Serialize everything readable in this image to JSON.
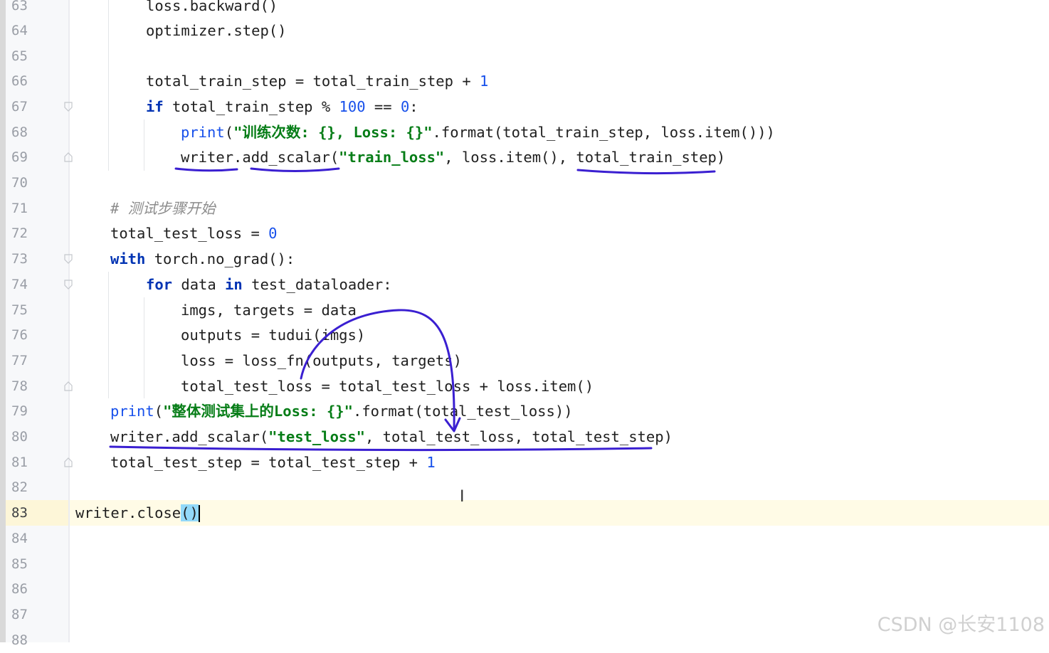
{
  "editor": {
    "line_numbers": [
      "63",
      "64",
      "65",
      "66",
      "67",
      "68",
      "69",
      "70",
      "71",
      "72",
      "73",
      "74",
      "75",
      "76",
      "77",
      "78",
      "79",
      "80",
      "81",
      "82",
      "83",
      "84",
      "85",
      "86",
      "87",
      "88"
    ],
    "current_line": "83",
    "lines": {
      "l63": [
        "loss.backward()"
      ],
      "l64": [
        "optimizer.step()"
      ],
      "l66": [
        "total_train_step = total_train_step + ",
        "1"
      ],
      "l67": [
        "if",
        " total_train_step % ",
        "100",
        " == ",
        "0",
        ":"
      ],
      "l68": [
        "print",
        "(",
        "\"训练次数: {}, Loss: {}\"",
        ".format(total_train_step, loss.item()))"
      ],
      "l69": [
        "writer.add_scalar(",
        "\"train_loss\"",
        ", loss.item(), total_train_step)"
      ],
      "l71": [
        "# 测试步骤开始"
      ],
      "l72": [
        "total_test_loss = ",
        "0"
      ],
      "l73": [
        "with",
        " torch.no_grad():"
      ],
      "l74": [
        "for",
        " data ",
        "in",
        " test_dataloader:"
      ],
      "l75": [
        "imgs, targets = data"
      ],
      "l76": [
        "outputs = tudui(imgs)"
      ],
      "l77": [
        "loss = loss_fn(outputs, targets)"
      ],
      "l78": [
        "total_test_loss = total_test_loss + loss.item()"
      ],
      "l79": [
        "print",
        "(",
        "\"整体测试集上的Loss: {}\"",
        ".format(total_test_loss))"
      ],
      "l80": [
        "writer.add_scalar(",
        "\"test_loss\"",
        ", total_test_loss, total_test_step)"
      ],
      "l81": [
        "total_test_step = total_test_step + ",
        "1"
      ],
      "l83": [
        "writer.close",
        "()"
      ]
    }
  },
  "watermark": "CSDN @长安1108",
  "colors": {
    "keyword": "#0033b3",
    "number": "#1750eb",
    "string": "#067d17",
    "comment": "#8c8c8c",
    "caret_row": "#fffbe6",
    "bracket_highlight": "#93d9f9",
    "annotation_ink": "#3a1fd1"
  }
}
